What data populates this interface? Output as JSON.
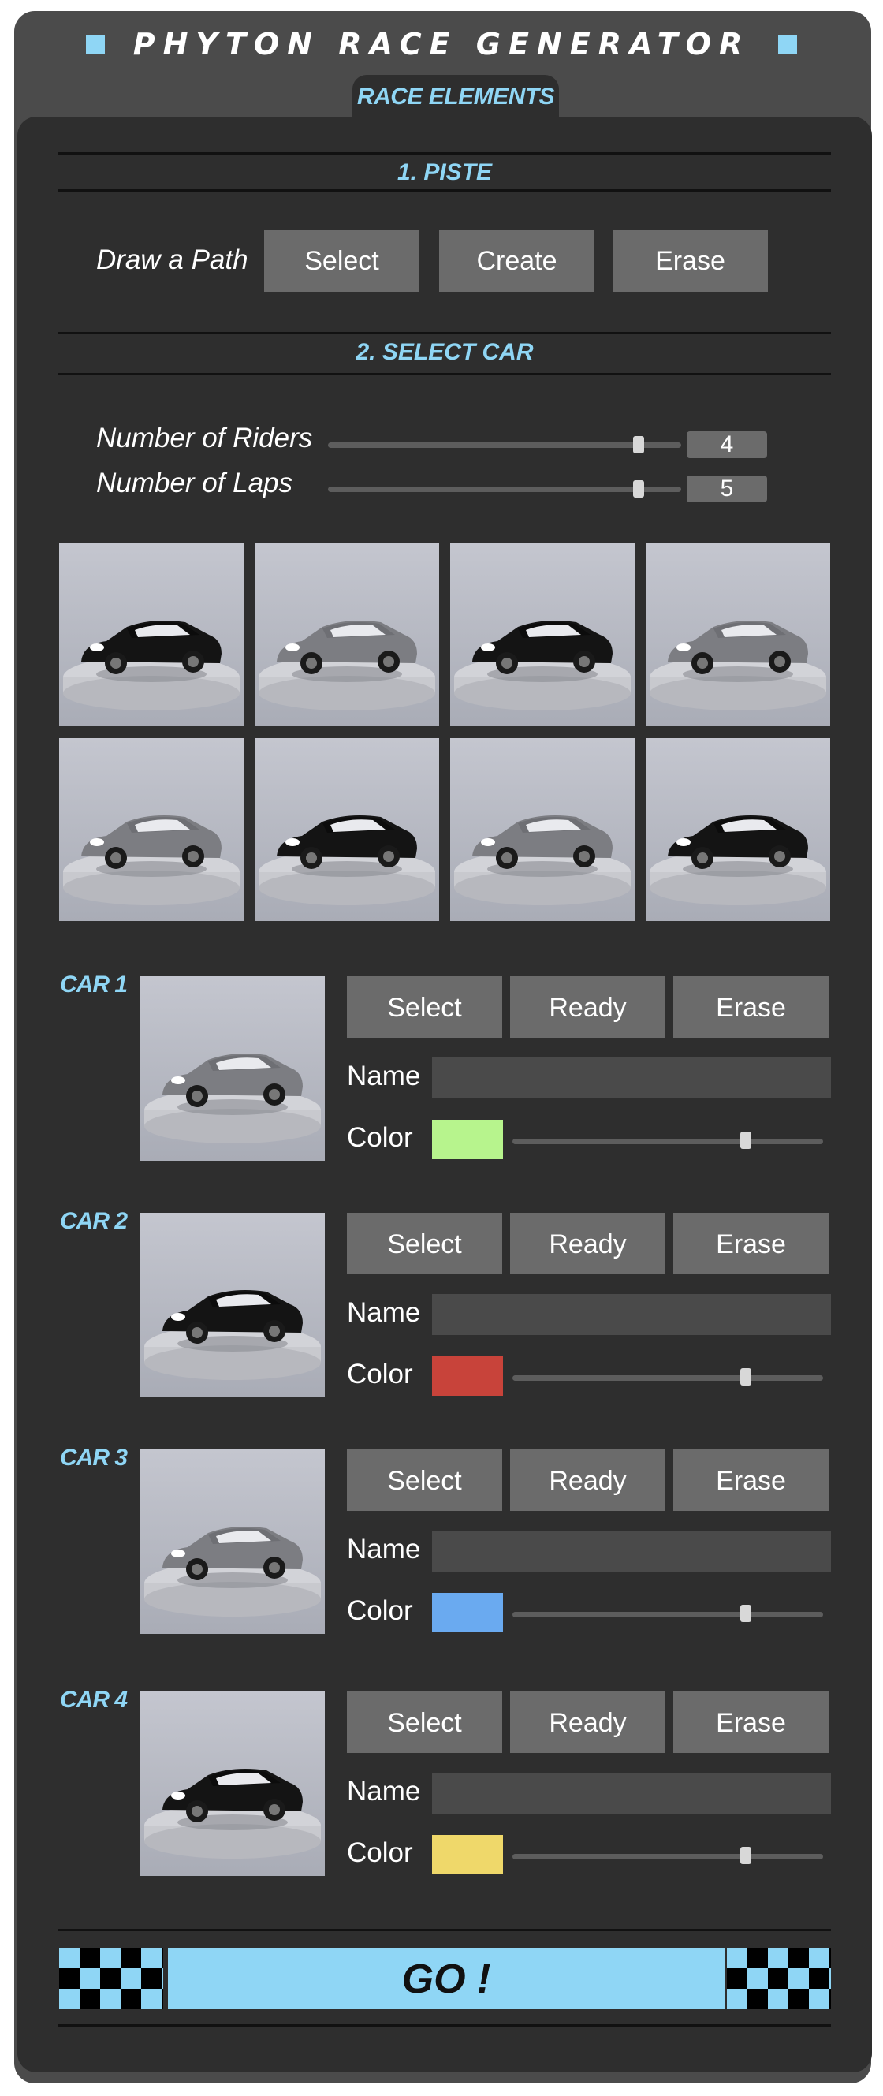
{
  "header": {
    "title": "PHYTON RACE GENERATOR",
    "tab_label": "RACE ELEMENTS"
  },
  "colors": {
    "accent": "#8fd6f5",
    "panel": "#2e2e2e",
    "frame": "#4b4b4b",
    "button": "#6b6b6b"
  },
  "piste": {
    "section_title": "1. PISTE",
    "label": "Draw a Path",
    "buttons": [
      "Select",
      "Create",
      "Erase"
    ]
  },
  "select_car": {
    "section_title": "2. SELECT CAR",
    "riders": {
      "label": "Number of Riders",
      "value": "4",
      "fraction": 0.88
    },
    "laps": {
      "label": "Number of Laps",
      "value": "5",
      "fraction": 0.88
    },
    "gallery": [
      "black",
      "grey",
      "black",
      "grey",
      "grey",
      "black",
      "grey",
      "black"
    ]
  },
  "cars": [
    {
      "label": "CAR 1",
      "image": "grey",
      "buttons": [
        "Select",
        "Ready",
        "Erase"
      ],
      "name_label": "Name",
      "name_value": "",
      "color_label": "Color",
      "color": "#b7f48d",
      "slider_fraction": 0.75
    },
    {
      "label": "CAR 2",
      "image": "black",
      "buttons": [
        "Select",
        "Ready",
        "Erase"
      ],
      "name_label": "Name",
      "name_value": "",
      "color_label": "Color",
      "color": "#c8433a",
      "slider_fraction": 0.75
    },
    {
      "label": "CAR 3",
      "image": "grey",
      "buttons": [
        "Select",
        "Ready",
        "Erase"
      ],
      "name_label": "Name",
      "name_value": "",
      "color_label": "Color",
      "color": "#6aaaf0",
      "slider_fraction": 0.75
    },
    {
      "label": "CAR 4",
      "image": "black",
      "buttons": [
        "Select",
        "Ready",
        "Erase"
      ],
      "name_label": "Name",
      "name_value": "",
      "color_label": "Color",
      "color": "#efd86a",
      "slider_fraction": 0.75
    }
  ],
  "go": {
    "label": "GO !"
  }
}
